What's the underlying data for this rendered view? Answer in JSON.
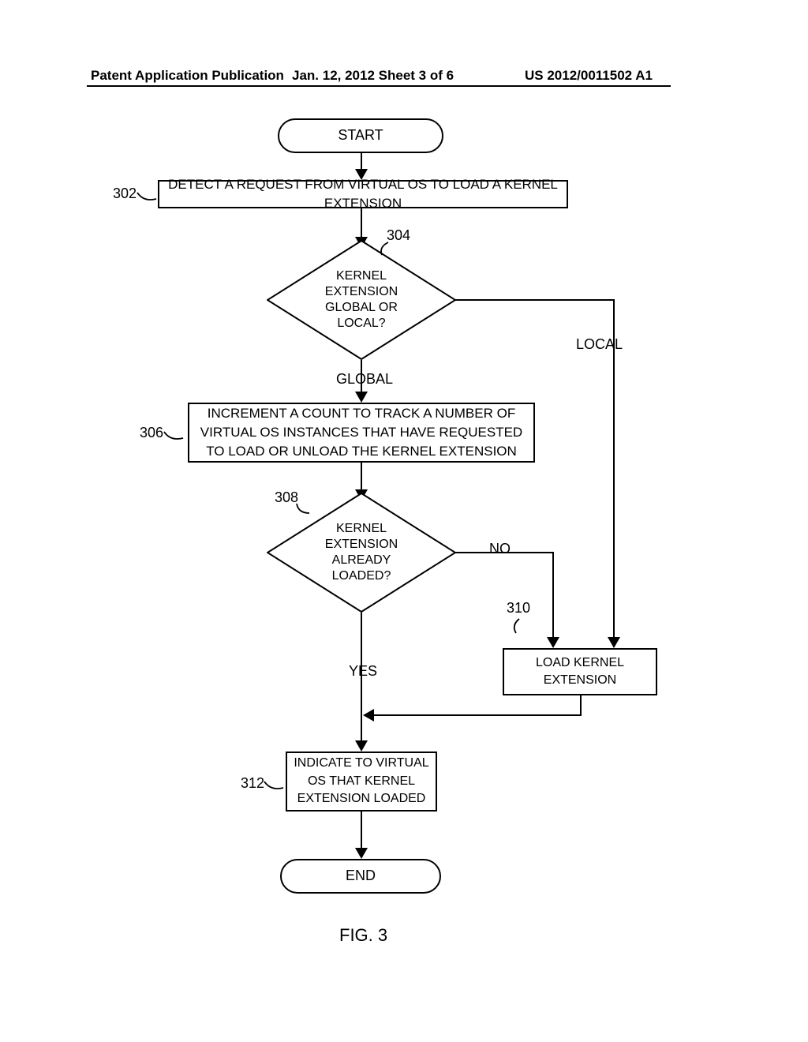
{
  "header": {
    "left": "Patent Application Publication",
    "center": "Jan. 12, 2012  Sheet 3 of 6",
    "right": "US 2012/0011502 A1"
  },
  "flow": {
    "start": "START",
    "step302": "DETECT A REQUEST FROM VIRTUAL OS TO LOAD A KERNEL EXTENSION",
    "d304_l1": "KERNEL",
    "d304_l2": "EXTENSION",
    "d304_l3": "GLOBAL OR",
    "d304_l4": "LOCAL?",
    "branch_global": "GLOBAL",
    "branch_local": "LOCAL",
    "step306": "INCREMENT A COUNT TO TRACK A NUMBER OF VIRTUAL OS INSTANCES THAT HAVE REQUESTED TO LOAD OR UNLOAD THE KERNEL EXTENSION",
    "d308_l1": "KERNEL",
    "d308_l2": "EXTENSION",
    "d308_l3": "ALREADY",
    "d308_l4": "LOADED?",
    "branch_no": "NO",
    "branch_yes": "YES",
    "step310": "LOAD KERNEL EXTENSION",
    "step312": "INDICATE TO VIRTUAL OS THAT KERNEL EXTENSION LOADED",
    "end": "END",
    "figure": "FIG. 3"
  },
  "refs": {
    "r302": "302",
    "r304": "304",
    "r306": "306",
    "r308": "308",
    "r310": "310",
    "r312": "312"
  }
}
